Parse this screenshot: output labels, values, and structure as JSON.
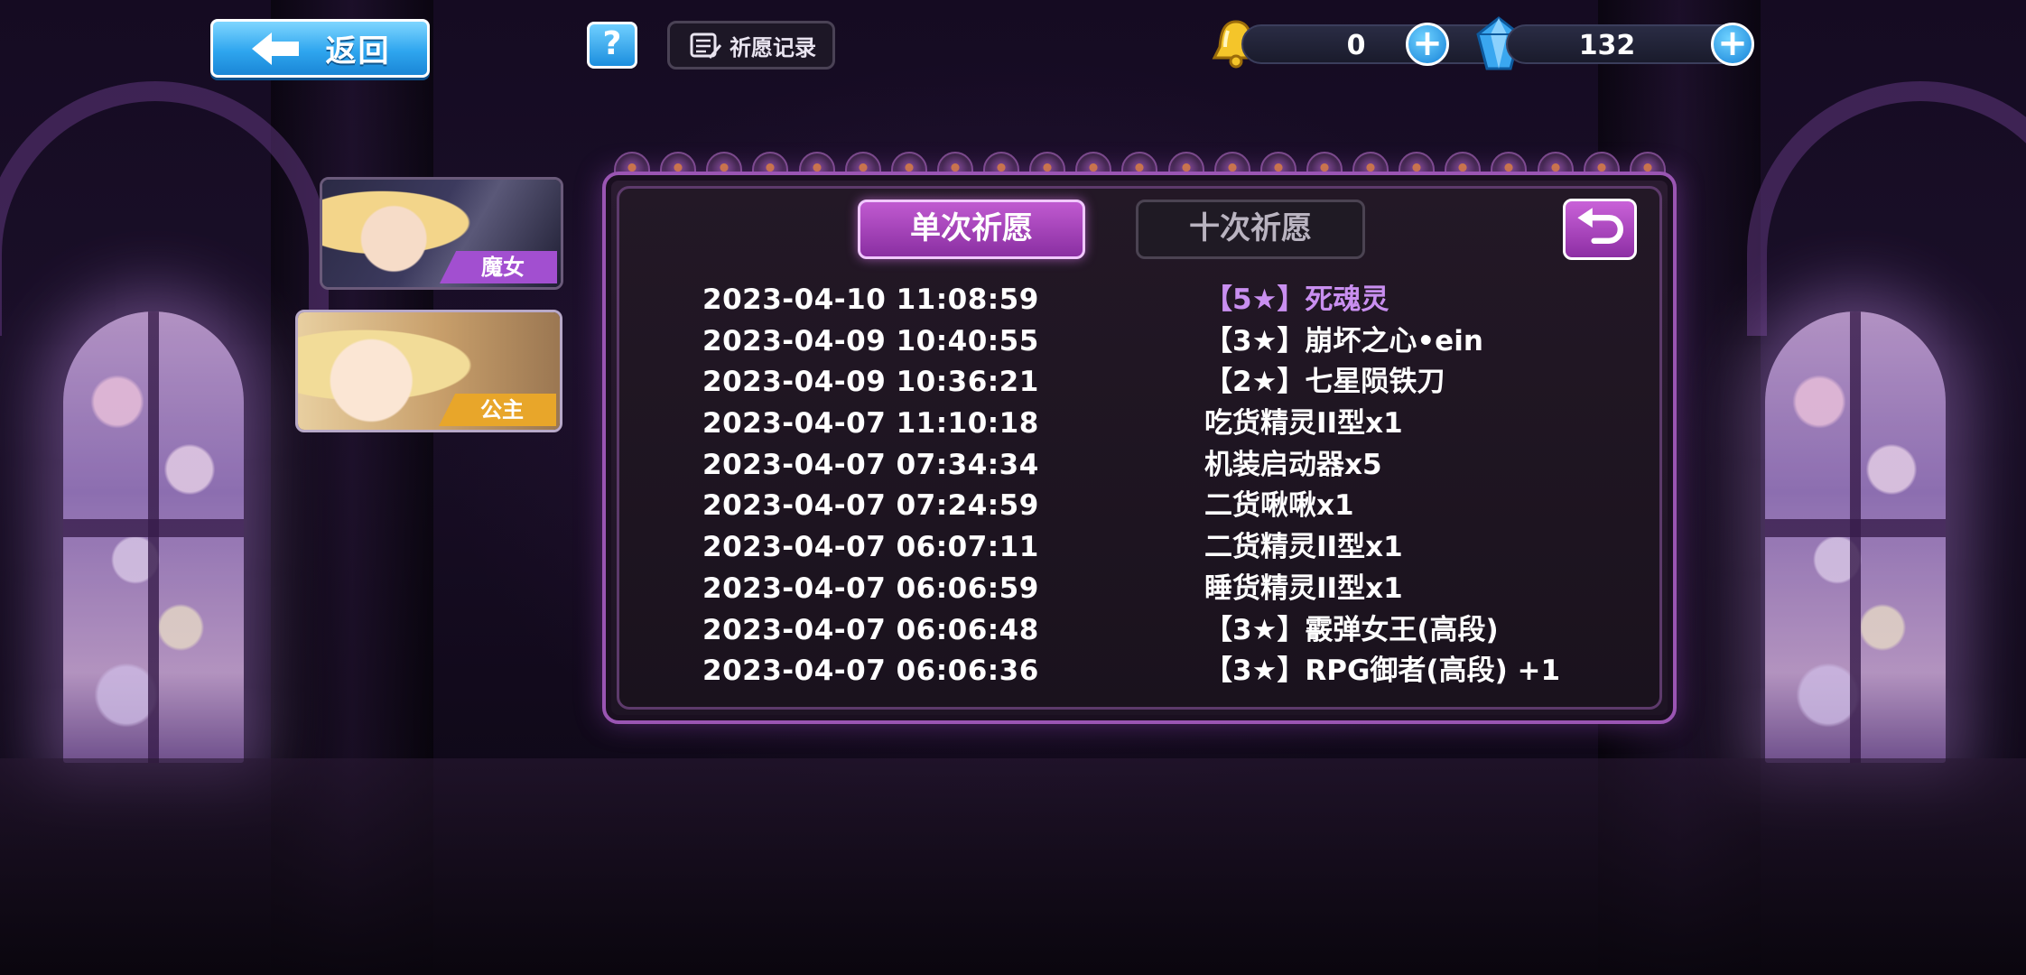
{
  "topbar": {
    "back_label": "返回",
    "help_label": "?",
    "record_label": "祈愿记录"
  },
  "currencies": [
    {
      "icon": "bell-icon",
      "value": "0",
      "plus": "+"
    },
    {
      "icon": "crystal-icon",
      "value": "132",
      "plus": "+"
    }
  ],
  "characters": [
    {
      "name": "witch",
      "label": "魔女",
      "tag_color": "#a24fd0"
    },
    {
      "name": "princess",
      "label": "公主",
      "tag_color": "#e8a62a"
    }
  ],
  "tabs": {
    "single": "单次祈愿",
    "ten": "十次祈愿"
  },
  "records": [
    {
      "time": "2023-04-10 11:08:59",
      "item": "【5★】死魂灵",
      "rare": true
    },
    {
      "time": "2023-04-09 10:40:55",
      "item": "【3★】崩坏之心•ein",
      "rare": false
    },
    {
      "time": "2023-04-09 10:36:21",
      "item": "【2★】七星陨铁刀",
      "rare": false
    },
    {
      "time": "2023-04-07 11:10:18",
      "item": "吃货精灵II型x1",
      "rare": false
    },
    {
      "time": "2023-04-07 07:34:34",
      "item": "机装启动器x5",
      "rare": false
    },
    {
      "time": "2023-04-07 07:24:59",
      "item": "二货啾啾x1",
      "rare": false
    },
    {
      "time": "2023-04-07 06:07:11",
      "item": "二货精灵II型x1",
      "rare": false
    },
    {
      "time": "2023-04-07 06:06:59",
      "item": "睡货精灵II型x1",
      "rare": false
    },
    {
      "time": "2023-04-07 06:06:48",
      "item": "【3★】霰弹女王(高段)",
      "rare": false
    },
    {
      "time": "2023-04-07 06:06:36",
      "item": "【3★】RPG御者(高段) +1",
      "rare": false
    }
  ],
  "colors": {
    "accent_blue": "#2fa6ef",
    "accent_purple": "#a43fc0",
    "rare_text": "#c98ff0"
  }
}
